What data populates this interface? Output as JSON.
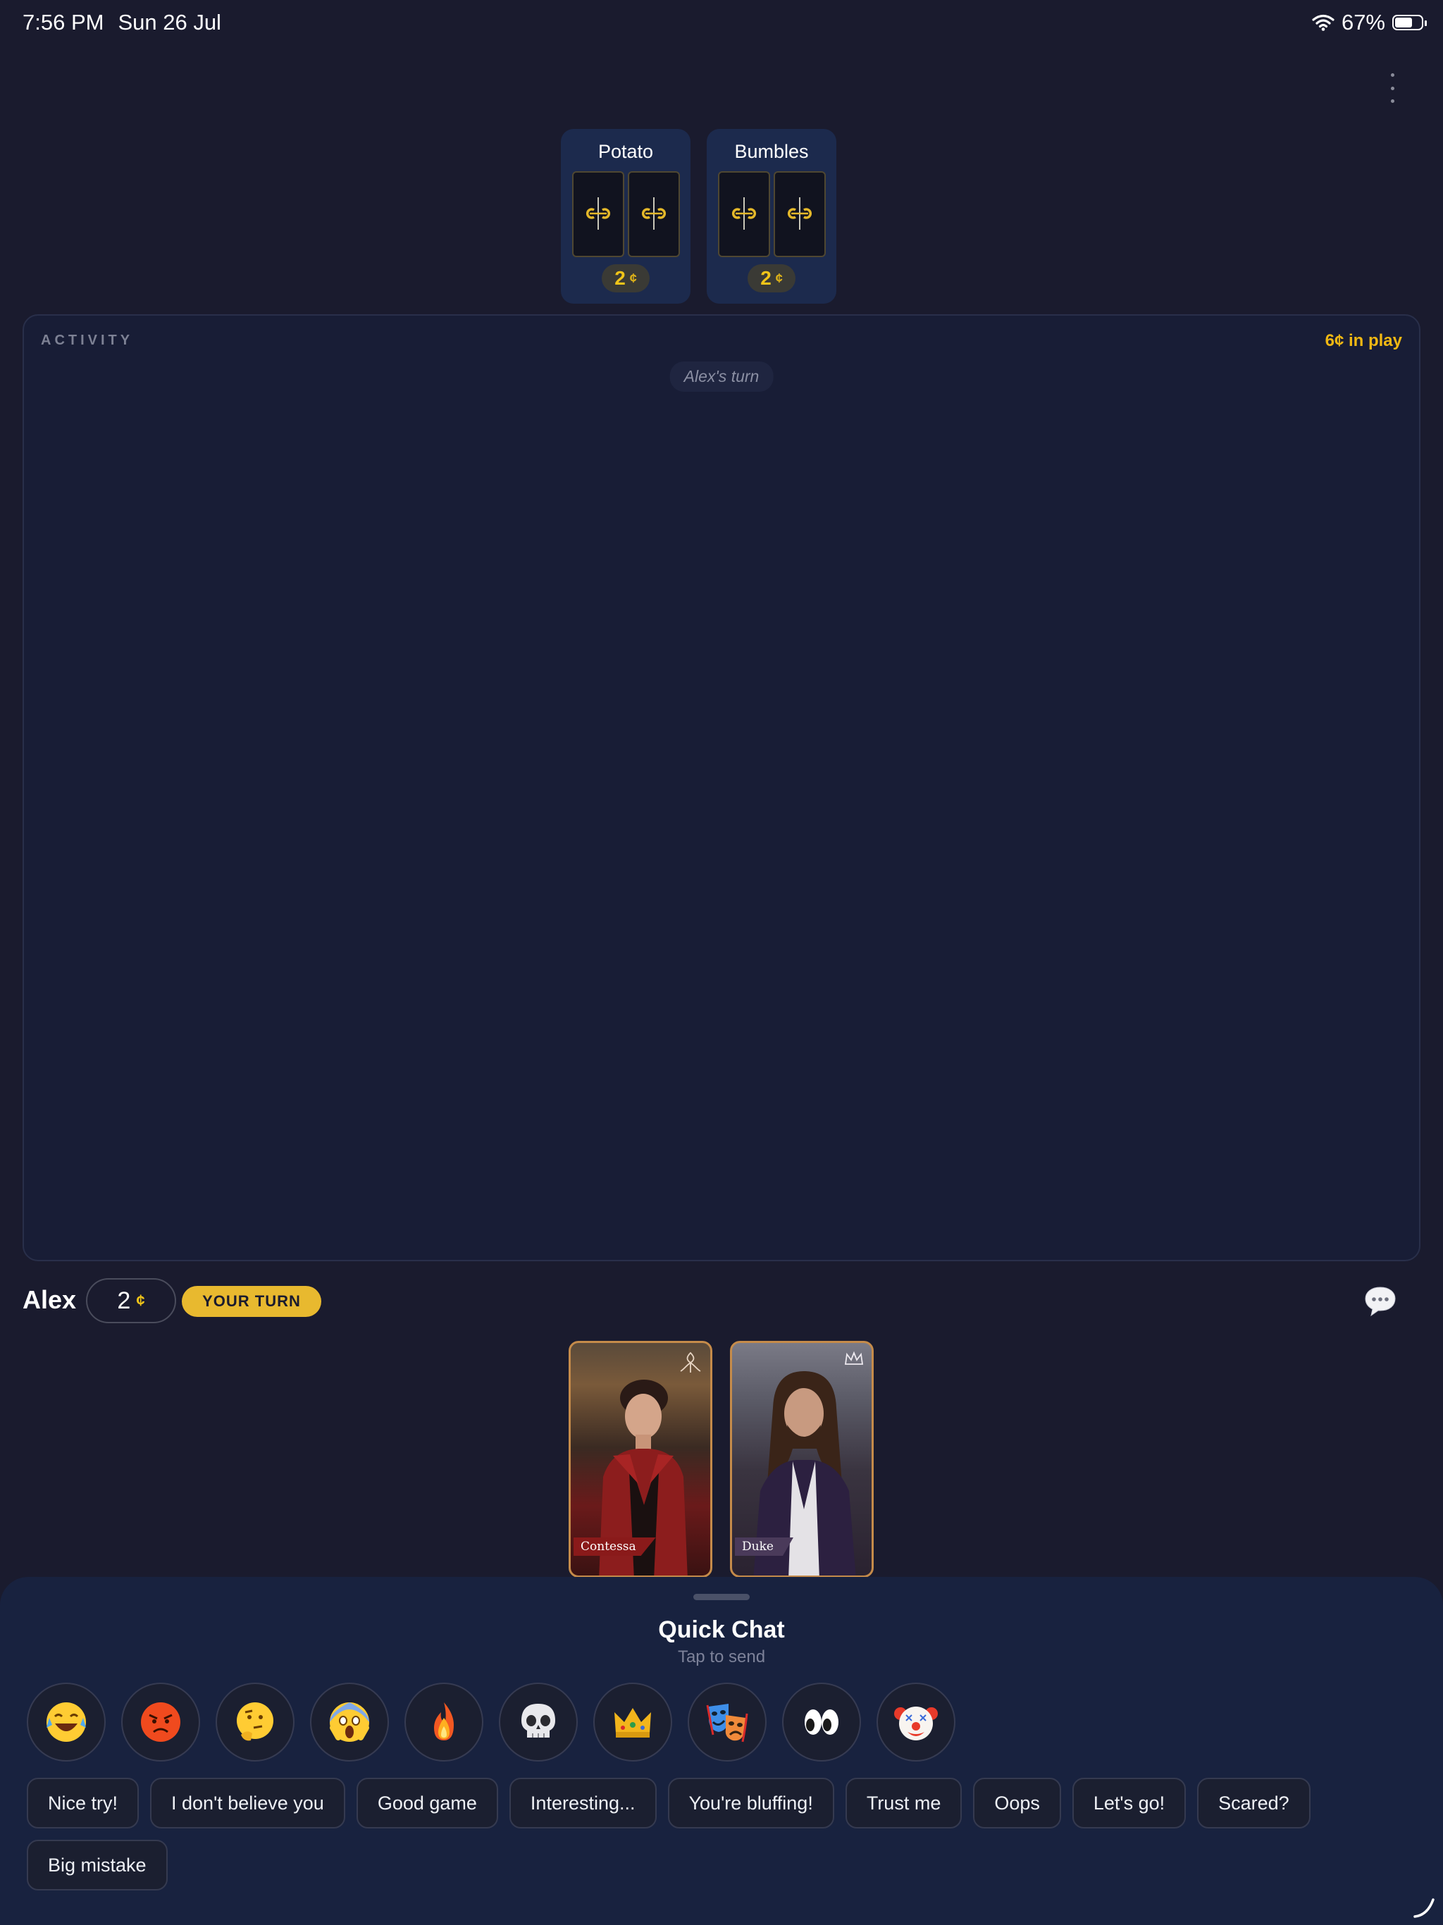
{
  "status_bar": {
    "time": "7:56 PM",
    "date": "Sun 26 Jul",
    "battery": "67%",
    "battery_level": 0.67
  },
  "opponents": [
    {
      "name": "Potato",
      "coins": "2",
      "coin_symbol": "¢"
    },
    {
      "name": "Bumbles",
      "coins": "2",
      "coin_symbol": "¢"
    }
  ],
  "activity": {
    "title": "ACTIVITY",
    "in_play": "6¢ in play",
    "turn_text": "Alex's turn"
  },
  "player": {
    "name": "Alex",
    "coins": "2",
    "coin_symbol": "¢",
    "turn_badge": "YOUR TURN"
  },
  "hand": [
    {
      "role": "Contessa"
    },
    {
      "role": "Duke"
    }
  ],
  "quick_chat": {
    "title": "Quick Chat",
    "subtitle": "Tap to send",
    "emojis": [
      "😂",
      "😡",
      "🤔",
      "😱",
      "🔥",
      "💀",
      "👑",
      "🎭",
      "👀",
      "🤡"
    ],
    "phrases": [
      "Nice try!",
      "I don't believe you",
      "Good game",
      "Interesting...",
      "You're bluffing!",
      "Trust me",
      "Oops",
      "Let's go!",
      "Scared?",
      "Big mistake"
    ]
  },
  "colors": {
    "background": "#1a1b2e",
    "accent_gold": "#e8b92f",
    "panel": "#18223f"
  }
}
